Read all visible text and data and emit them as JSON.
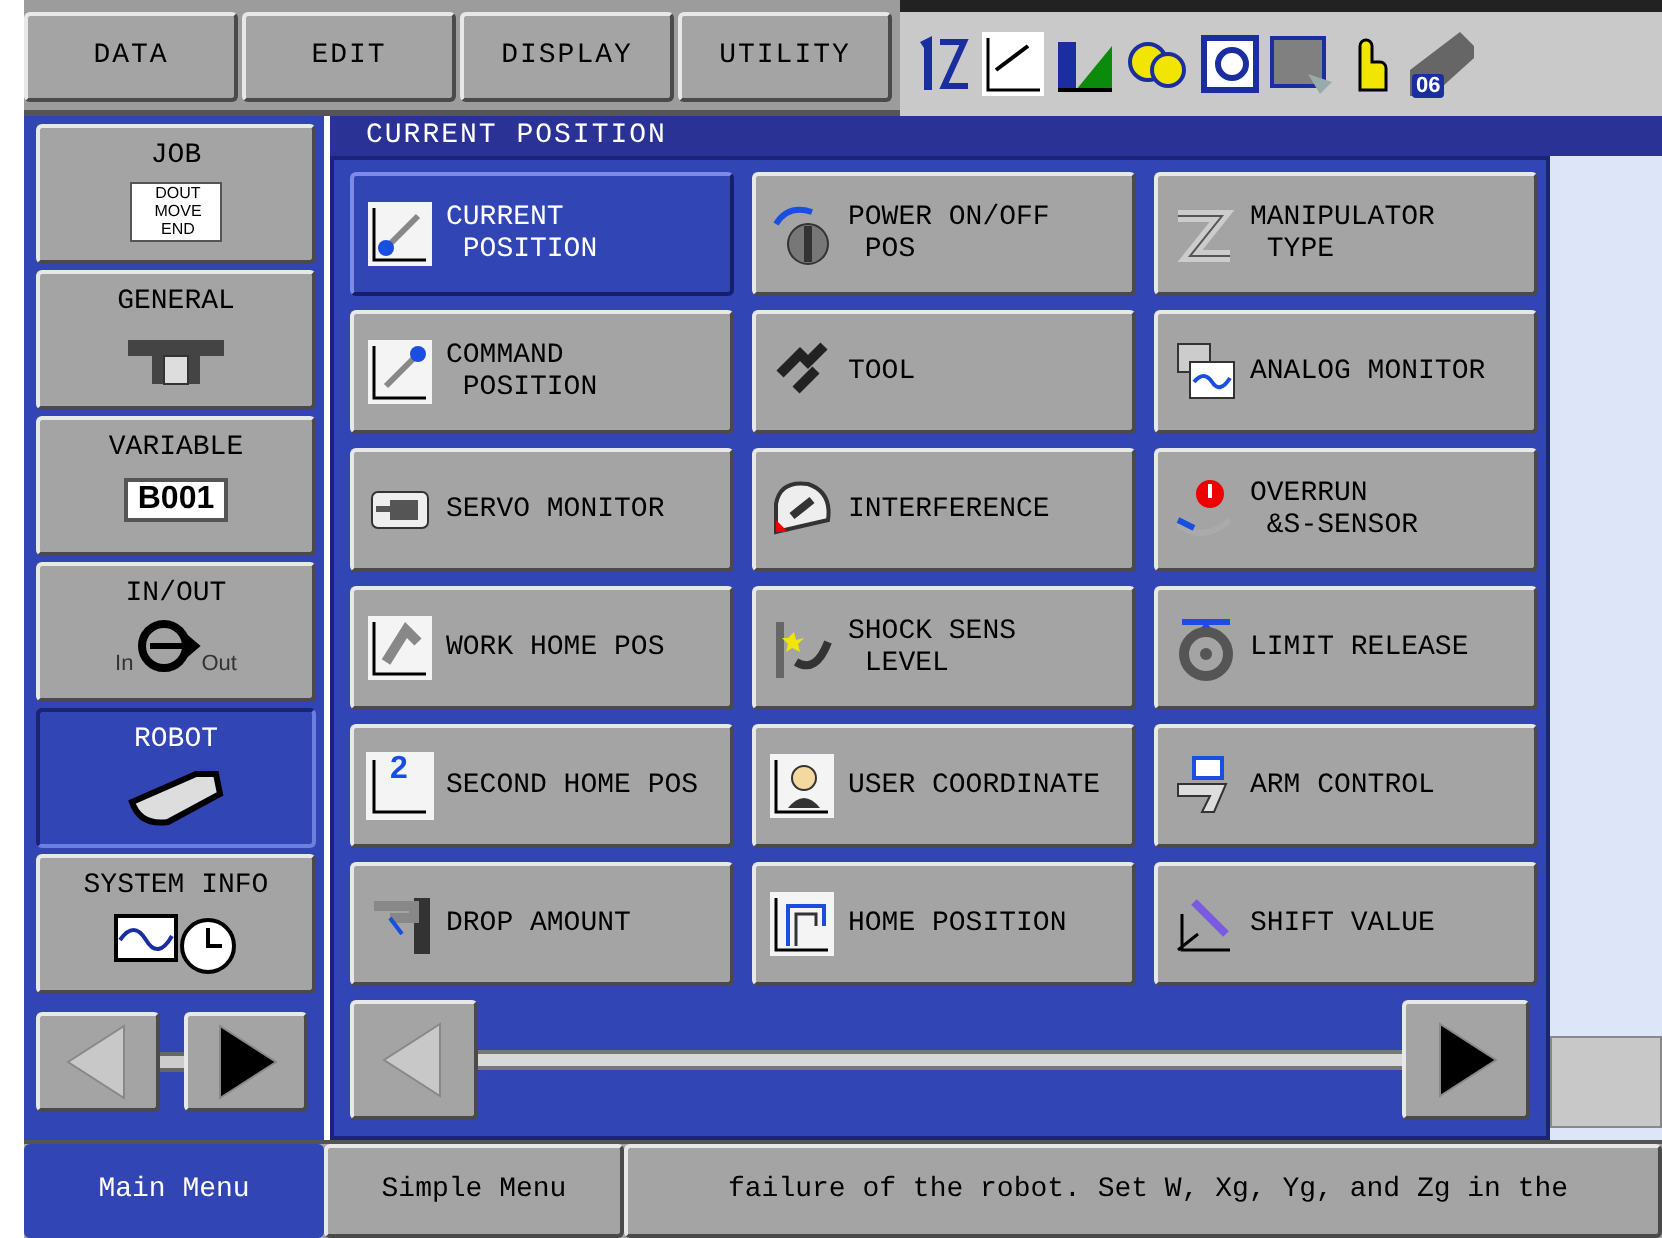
{
  "top_menu": [
    {
      "label": "DATA"
    },
    {
      "label": "EDIT"
    },
    {
      "label": "DISPLAY"
    },
    {
      "label": "UTILITY"
    }
  ],
  "status_icons": {
    "badge": "06"
  },
  "sidebar": {
    "items": [
      {
        "label": "JOB",
        "selected": false,
        "icon_text": [
          "DOUT",
          "MOVE",
          "END"
        ]
      },
      {
        "label": "GENERAL",
        "selected": false
      },
      {
        "label": "VARIABLE",
        "selected": false,
        "icon_text": [
          "B001"
        ]
      },
      {
        "label": "IN/OUT",
        "selected": false,
        "icon_text": [
          "In",
          "Out"
        ]
      },
      {
        "label": "ROBOT",
        "selected": true
      },
      {
        "label": "SYSTEM INFO",
        "selected": false
      }
    ],
    "prev_disabled": true,
    "next_disabled": false
  },
  "screen_title": "CURRENT POSITION",
  "menu": {
    "items": [
      {
        "lines": [
          "CURRENT",
          " POSITION"
        ],
        "selected": true
      },
      {
        "lines": [
          "POWER ON/OFF",
          " POS"
        ],
        "selected": false
      },
      {
        "lines": [
          "MANIPULATOR",
          " TYPE"
        ],
        "selected": false
      },
      {
        "lines": [
          "COMMAND",
          " POSITION"
        ],
        "selected": false
      },
      {
        "lines": [
          "TOOL"
        ],
        "selected": false
      },
      {
        "lines": [
          "ANALOG MONITOR"
        ],
        "selected": false
      },
      {
        "lines": [
          "SERVO MONITOR"
        ],
        "selected": false
      },
      {
        "lines": [
          "INTERFERENCE"
        ],
        "selected": false
      },
      {
        "lines": [
          "OVERRUN",
          " &S-SENSOR"
        ],
        "selected": false
      },
      {
        "lines": [
          "WORK HOME POS"
        ],
        "selected": false
      },
      {
        "lines": [
          "SHOCK SENS",
          " LEVEL"
        ],
        "selected": false
      },
      {
        "lines": [
          "LIMIT RELEASE"
        ],
        "selected": false
      },
      {
        "lines": [
          "SECOND HOME POS"
        ],
        "selected": false,
        "icon_text": "2"
      },
      {
        "lines": [
          "USER COORDINATE"
        ],
        "selected": false
      },
      {
        "lines": [
          "ARM CONTROL"
        ],
        "selected": false
      },
      {
        "lines": [
          "DROP AMOUNT"
        ],
        "selected": false
      },
      {
        "lines": [
          "HOME POSITION"
        ],
        "selected": false
      },
      {
        "lines": [
          "SHIFT VALUE"
        ],
        "selected": false
      }
    ],
    "prev_disabled": true,
    "next_disabled": false
  },
  "bottom_bar": {
    "tabs": [
      {
        "label": "Main Menu",
        "selected": true
      },
      {
        "label": "Simple Menu",
        "selected": false
      }
    ],
    "message": "failure of the robot. Set W, Xg, Yg, and Zg in the"
  }
}
